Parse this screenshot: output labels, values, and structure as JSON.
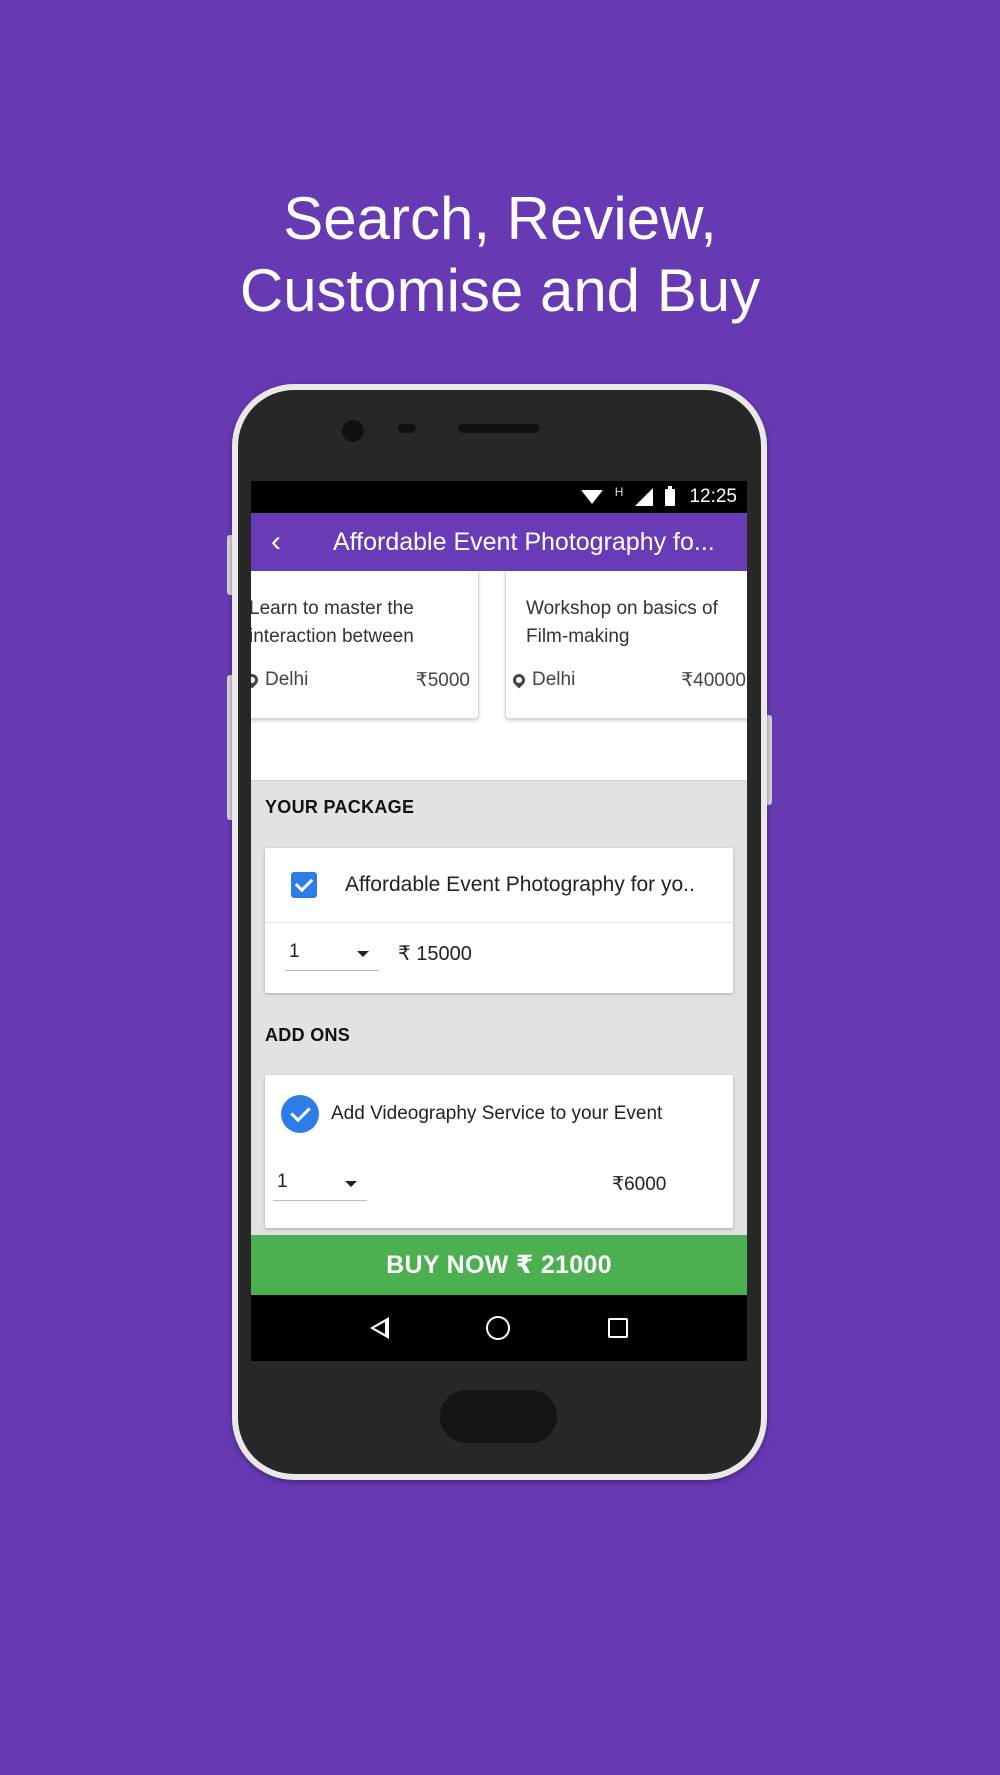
{
  "headline": {
    "line1": "Search, Review,",
    "line2": "Customise and Buy"
  },
  "status_bar": {
    "network_type": "H",
    "time": "12:25",
    "icons": [
      "wifi-icon",
      "signal-icon",
      "battery-icon"
    ]
  },
  "app_bar": {
    "back_icon": "‹",
    "title": "Affordable Event Photography fo..."
  },
  "related_cards": [
    {
      "description": "Learn to master the interaction between",
      "location": "Delhi",
      "price": "₹5000"
    },
    {
      "description": "Workshop on basics of Film-making",
      "location": "Delhi",
      "price": "₹40000"
    }
  ],
  "package": {
    "section_label": "YOUR PACKAGE",
    "name": "Affordable Event Photography for yo..",
    "checked": true,
    "quantity": "1",
    "price": "₹ 15000"
  },
  "addons": {
    "section_label": "ADD ONS",
    "items": [
      {
        "name": "Add Videography Service to your Event",
        "checked": true,
        "quantity": "1",
        "price": "₹6000"
      }
    ]
  },
  "buy_button": {
    "label": "BUY NOW ₹ 21000"
  },
  "colors": {
    "background": "#673AB4",
    "app_bar": "#6A3BB6",
    "buy_button": "#4CAF50",
    "checkbox": "#2D7CE8"
  }
}
